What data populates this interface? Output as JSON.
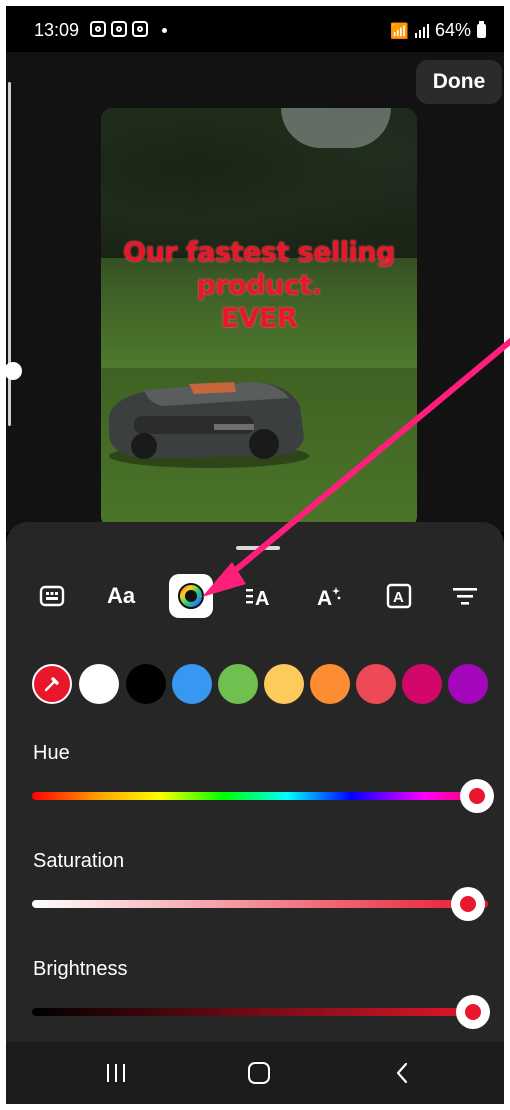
{
  "status_bar": {
    "time": "13:09",
    "battery": "64%"
  },
  "editor": {
    "done_label": "Done",
    "overlay_text_lines": [
      "Our fastest selling",
      "product.",
      "EVER"
    ],
    "overlay_text_color": "#e8172b"
  },
  "text_tools": [
    {
      "name": "keyboard-tool",
      "icon": "keyboard-icon"
    },
    {
      "name": "font-tool",
      "label": "Aa"
    },
    {
      "name": "color-tool",
      "icon": "color-wheel-icon",
      "active": true
    },
    {
      "name": "alignment-tool",
      "icon": "text-align-icon"
    },
    {
      "name": "effects-tool",
      "icon": "text-effects-icon"
    },
    {
      "name": "background-tool",
      "icon": "text-background-icon"
    },
    {
      "name": "more-tool",
      "icon": "lines-menu-icon"
    }
  ],
  "color_swatches": [
    "#e8172b",
    "#ffffff",
    "#000000",
    "#3897f0",
    "#70c050",
    "#fdcb5c",
    "#fd8d32",
    "#ed4956",
    "#d10869",
    "#a307ba"
  ],
  "sliders": {
    "hue": {
      "label": "Hue",
      "value": 1.0
    },
    "saturation": {
      "label": "Saturation",
      "value": 0.96
    },
    "brightness": {
      "label": "Brightness",
      "value": 0.97
    }
  },
  "annotation_color": "#ff1f7a"
}
